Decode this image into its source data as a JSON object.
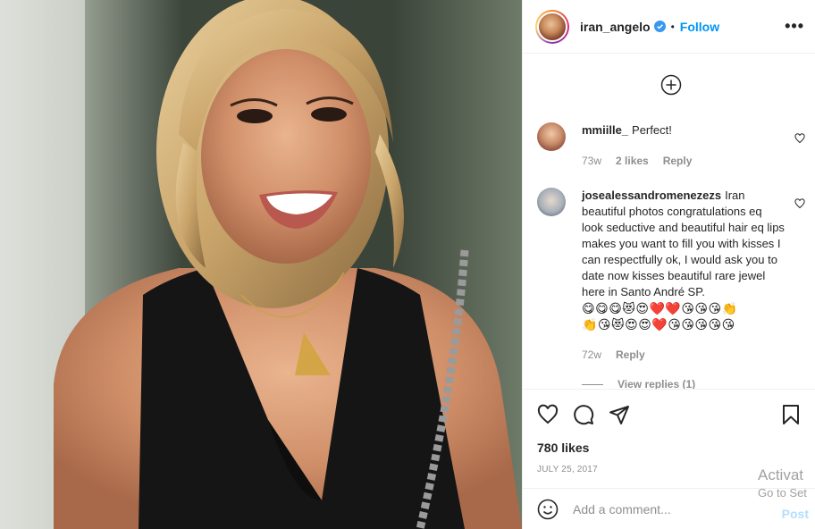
{
  "post": {
    "image_alt": "",
    "username": "iran_angelo",
    "verified": true,
    "separator": "•",
    "follow_label": "Follow",
    "more_label": "•••"
  },
  "comments": [
    {
      "username": "mmiille_",
      "text": "Perfect!",
      "age": "73w",
      "likes": "2 likes",
      "reply_label": "Reply"
    },
    {
      "username": "josealessandromenezezs",
      "text": "Iran beautiful photos congratulations eq look seductive and beautiful hair eq lips makes you want to fill you with kisses I can respectfully ok, I would ask you to date now kisses beautiful rare jewel here in Santo André SP.",
      "emojis_line1": "😋😋😋😻😍❤️❤️😘😘😘👏",
      "emojis_line2": "👏😘😻😍😍❤️😘😘😘😘😘",
      "age": "72w",
      "reply_label": "Reply",
      "view_replies": "View replies (1)"
    }
  ],
  "engagement": {
    "likes": "780 likes",
    "date": "JULY 25, 2017"
  },
  "composer": {
    "placeholder": "Add a comment...",
    "post_label": "Post"
  },
  "watermark": {
    "title": "Activat",
    "subtitle": "Go to Set"
  },
  "colors": {
    "accent": "#0095f6",
    "post_disabled": "#b2dffc",
    "muted": "#8e8e8e"
  }
}
